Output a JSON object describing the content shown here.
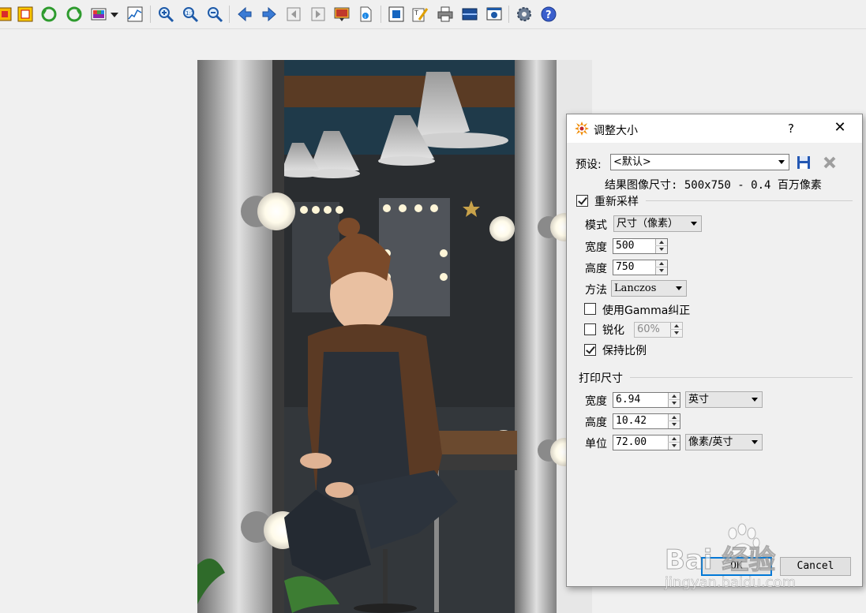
{
  "toolbar": {
    "icons": [
      "show-original-icon",
      "crop-icon",
      "rotate-left-icon",
      "rotate-right-icon",
      "colors-icon",
      "dropdown-arrow-icon",
      "histogram-icon",
      "zoom-in-icon",
      "zoom-fit-icon",
      "zoom-out-icon",
      "arrow-left-icon",
      "arrow-right-icon",
      "first-file-icon",
      "last-file-icon",
      "slideshow-icon",
      "file-info-icon",
      "fullscreen-icon",
      "edit-icon",
      "print-icon",
      "scanner-icon",
      "screenshot-icon",
      "settings-icon",
      "help-icon"
    ]
  },
  "dialog": {
    "title": "调整大小",
    "help": "?",
    "close": "✕",
    "preset_label": "预设:",
    "preset_value": "<默认>",
    "result_text": "结果图像尺寸: 500x750 - 0.4 百万像素",
    "resample_label": "重新采样",
    "resample_checked": true,
    "mode_label": "模式",
    "mode_value": "尺寸（像素）",
    "width_label": "宽度",
    "width_value": "500",
    "height_label": "高度",
    "height_value": "750",
    "method_label": "方法",
    "method_value": "Lanczos",
    "gamma_label": "使用Gamma纠正",
    "gamma_checked": false,
    "sharpen_label": "锐化",
    "sharpen_checked": false,
    "sharpen_value": "60%",
    "keep_ratio_label": "保持比例",
    "keep_ratio_checked": true,
    "print_group_label": "打印尺寸",
    "print_width_label": "宽度",
    "print_width_value": "6.94",
    "print_width_unit": "英寸",
    "print_height_label": "高度",
    "print_height_value": "10.42",
    "unit_label": "单位",
    "unit_value": "72.00",
    "unit_unit": "像素/英寸",
    "ok_label": "OK",
    "cancel_label": "Cancel"
  },
  "watermark": {
    "brand": "Bai 经验",
    "url": "jingyan.baidu.com"
  },
  "colors": {
    "accent": "#0078d7",
    "toolbar_bg": "#f0f0f0"
  }
}
